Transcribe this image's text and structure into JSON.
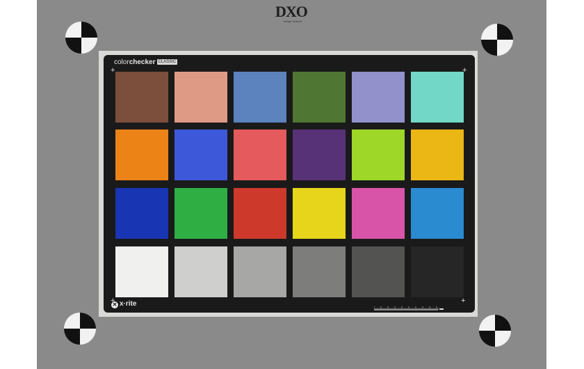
{
  "logo": {
    "text": "DXO",
    "tagline": "Image Science"
  },
  "chart": {
    "brand_prefix": "color",
    "brand_bold": "checker",
    "edition": "CLASSIC",
    "maker": "x·rite",
    "maker_icon": "x-rite-logo-icon",
    "rows": [
      [
        "#7b4f3b",
        "#df9a86",
        "#5d83be",
        "#4f7632",
        "#9291cc",
        "#73d7c7"
      ],
      [
        "#ec8317",
        "#3d59d9",
        "#e55a5c",
        "#583277",
        "#9fd728",
        "#eab714"
      ],
      [
        "#1835b4",
        "#2fae44",
        "#cd3a2b",
        "#e6d51a",
        "#d854a9",
        "#2a8bd0"
      ],
      [
        "#f0f0ee",
        "#cfcfcd",
        "#a7a7a5",
        "#7d7d7b",
        "#535351",
        "#262626"
      ]
    ]
  },
  "colors": {
    "board": "#8a8a8a",
    "card": "#1a1a1a",
    "mount": "#d9d9d7"
  }
}
